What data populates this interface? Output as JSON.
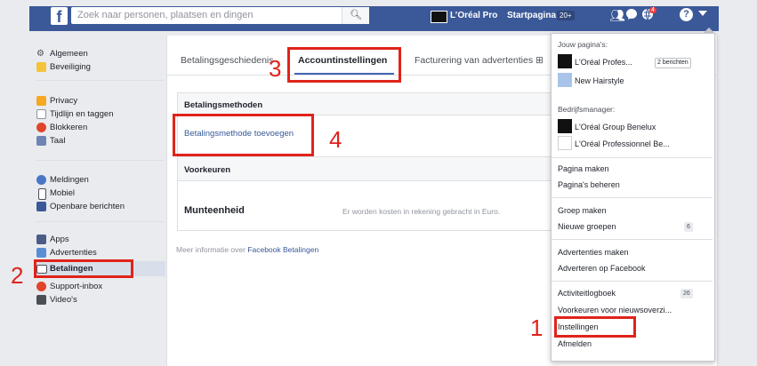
{
  "topbar": {
    "search_placeholder": "Zoek naar personen, plaatsen en dingen",
    "search_icon": "magnifier-icon",
    "brand_name": "L’Oréal Pro",
    "home_label": "Startpagina",
    "home_count": "20+",
    "notifications_count": "4",
    "colors": {
      "bar": "#3b5998",
      "badge": "#fa3e3e"
    }
  },
  "sidebar": {
    "group1": [
      {
        "label": "Algemeen",
        "icon": "gear-icon"
      },
      {
        "label": "Beveiliging",
        "icon": "shield-icon"
      }
    ],
    "group2": [
      {
        "label": "Privacy",
        "icon": "lock-icon"
      },
      {
        "label": "Tijdlijn en taggen",
        "icon": "timeline-icon"
      },
      {
        "label": "Blokkeren",
        "icon": "block-icon"
      },
      {
        "label": "Taal",
        "icon": "language-icon"
      }
    ],
    "group3": [
      {
        "label": "Meldingen",
        "icon": "globe-icon"
      },
      {
        "label": "Mobiel",
        "icon": "phone-icon"
      },
      {
        "label": "Openbare berichten",
        "icon": "rss-icon"
      }
    ],
    "group4": [
      {
        "label": "Apps",
        "icon": "apps-icon"
      },
      {
        "label": "Advertenties",
        "icon": "ads-icon"
      },
      {
        "label": "Betalingen",
        "icon": "card-icon"
      },
      {
        "label": "Support-inbox",
        "icon": "lifebuoy-icon"
      },
      {
        "label": "Video's",
        "icon": "film-icon"
      }
    ]
  },
  "main": {
    "tabs": [
      {
        "label": "Betalingsgeschiedenis"
      },
      {
        "label": "Accountinstellingen"
      },
      {
        "label": "Facturering van advertenties ⊞"
      }
    ],
    "payment_methods_title": "Betalingsmethoden",
    "add_payment_method": "Betalingsmethode toevoegen",
    "preferences_title": "Voorkeuren",
    "currency_label": "Munteenheid",
    "currency_value": "Er worden kosten in rekening gebracht in Euro.",
    "info_prefix": "Meer informatie over ",
    "info_link": "Facebook Betalingen"
  },
  "dropdown": {
    "pages_heading": "Jouw pagina's:",
    "pages": [
      {
        "label": "L'Oréal Profes...",
        "pill": "2 berichten"
      },
      {
        "label": "New Hairstyle"
      }
    ],
    "business_heading": "Bedrijfsmanager:",
    "business": [
      {
        "label": "L'Oréal Group Benelux"
      },
      {
        "label": "L'Oréal Professionnel Be..."
      }
    ],
    "items_a": [
      "Pagina maken",
      "Pagina's beheren"
    ],
    "items_b": [
      {
        "label": "Groep maken"
      },
      {
        "label": "Nieuwe groepen",
        "count": "6"
      }
    ],
    "items_c": [
      "Advertenties maken",
      "Adverteren op Facebook"
    ],
    "items_d": [
      {
        "label": "Activiteitlogboek",
        "count": "26"
      },
      {
        "label": "Voorkeuren voor nieuwsoverzi..."
      },
      {
        "label": "Instellingen"
      },
      {
        "label": "Afmelden"
      }
    ]
  },
  "annotations": [
    "1",
    "2",
    "3",
    "4"
  ],
  "annotation_color": "#e0231b"
}
